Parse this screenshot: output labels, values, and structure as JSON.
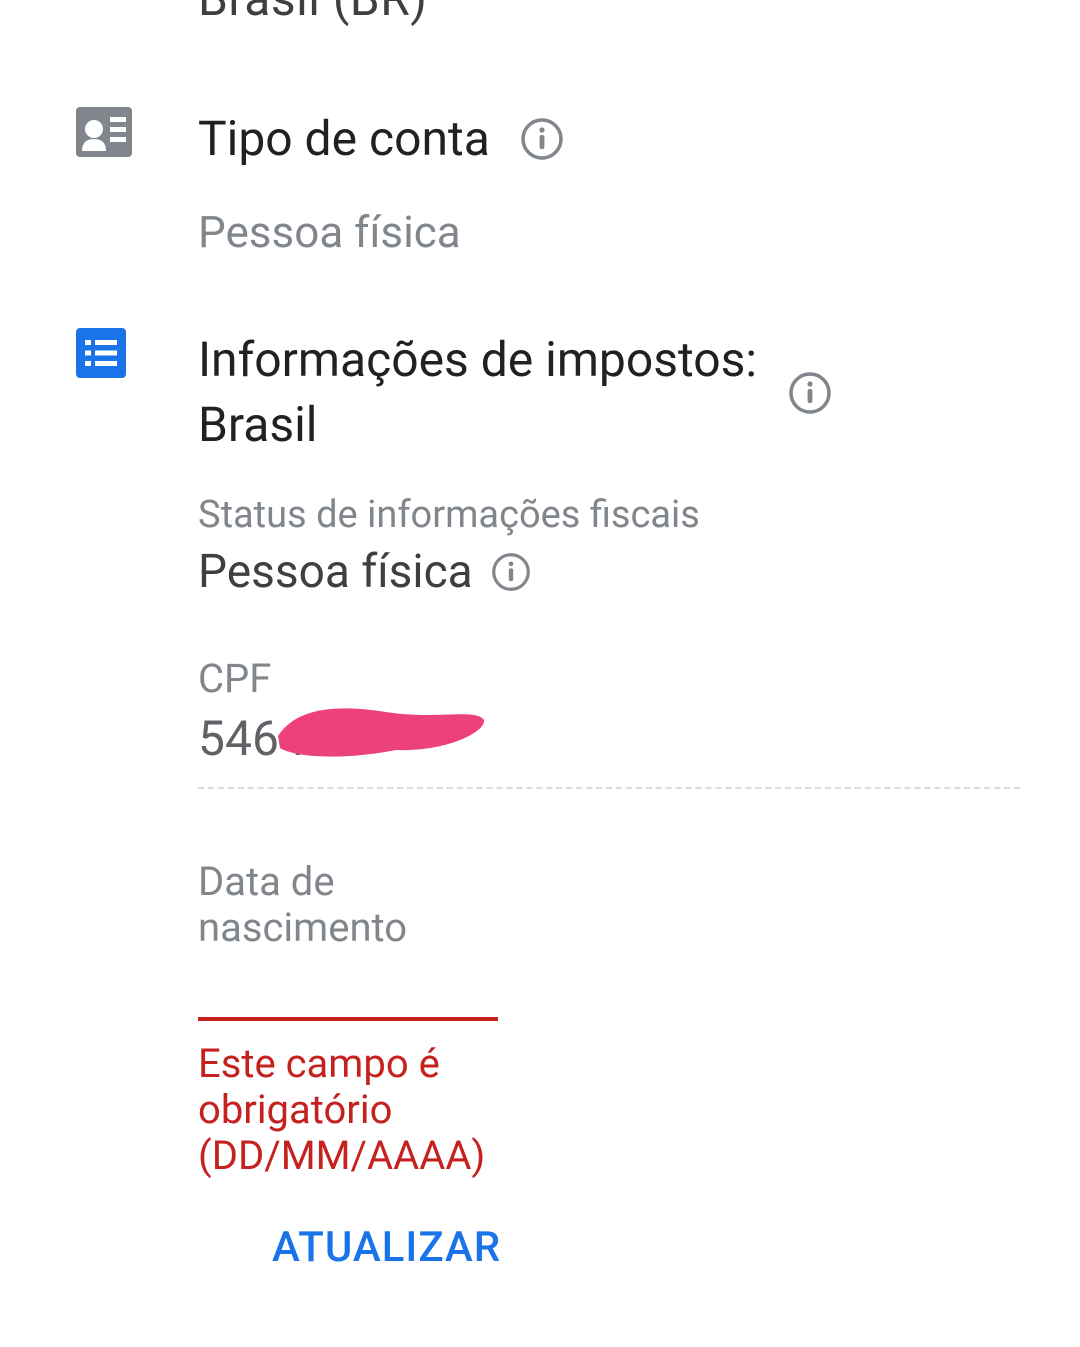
{
  "top_cut": "Brasil (BR)",
  "account_type": {
    "title": "Tipo de conta",
    "value": "Pessoa física"
  },
  "tax_info": {
    "title": "Informações de impostos: Brasil",
    "status_label": "Status de informações fiscais",
    "status_value": "Pessoa física",
    "cpf_label": "CPF",
    "cpf_value": "5464",
    "dob_label": "Data de nascimento",
    "dob_value": "",
    "dob_error": "Este campo é obrigatório (DD/MM/AAAA)",
    "update_button": "ATUALIZAR"
  }
}
